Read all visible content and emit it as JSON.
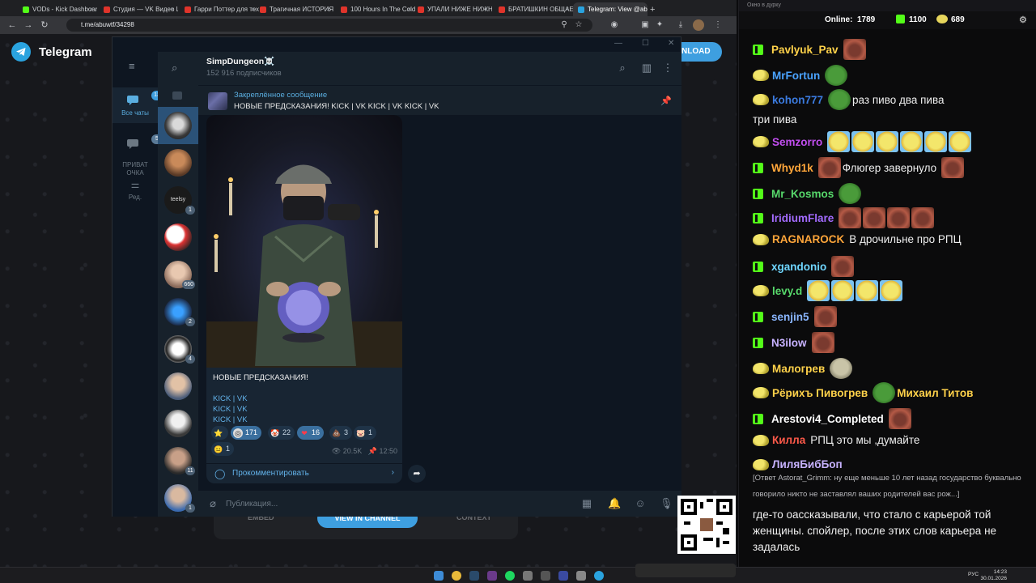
{
  "browser": {
    "tabs": [
      {
        "label": "VODs - Kick Dashboard",
        "color": "#53fc18"
      },
      {
        "label": "Студия — VK Видео Li",
        "color": "#e0342b"
      },
      {
        "label": "Гарри Поттер для тех",
        "color": "#e0342b"
      },
      {
        "label": "Трагичная ИСТОРИЯ",
        "color": "#e0342b"
      },
      {
        "label": "100 Hours In The Cold",
        "color": "#e0342b"
      },
      {
        "label": "УПАЛИ НИЖЕ НИЖН",
        "color": "#e0342b"
      },
      {
        "label": "БРАТИШКИН ОБЩАЕ",
        "color": "#e0342b"
      },
      {
        "label": "Telegram: View @abus",
        "color": "#2aa3df"
      }
    ],
    "url": "t.me/abuwtf/34298"
  },
  "page": {
    "brand": "Telegram",
    "download_label": "NLOAD",
    "bottom_buttons": {
      "embed": "EMBED",
      "view_channel": "VIEW IN CHANNEL",
      "context": "CONTEXT"
    }
  },
  "tg": {
    "folders": [
      {
        "label": "Все чаты",
        "badge": "13"
      },
      {
        "label": "ПРИВАТ\nОЧКА",
        "badge": "5"
      },
      {
        "label": "Ред.",
        "badge": ""
      }
    ],
    "chat_badges": [
      "1",
      "660",
      "2",
      "4",
      "11",
      "1"
    ],
    "channel": {
      "title": "SimpDungeon☠️",
      "subscribers": "152 916 подписчиков"
    },
    "pinned": {
      "label": "Закреплённое сообщение",
      "text": "НОВЫЕ ПРЕДСКАЗАНИЯ!  KICK | VK KICK | VK KICK | VK"
    },
    "post": {
      "title": "НОВЫЕ ПРЕДСКАЗАНИЯ!",
      "lines": [
        "KICK | VK",
        "KICK | VK",
        "KICK | VK"
      ],
      "reactions": [
        {
          "emoji": "⭐",
          "count": ""
        },
        {
          "emoji": "◎",
          "count": "171"
        },
        {
          "emoji": "🤡",
          "count": "22"
        },
        {
          "emoji": "❤",
          "count": "16"
        },
        {
          "emoji": "💩",
          "count": "3"
        },
        {
          "emoji": "🐷",
          "count": "1"
        },
        {
          "emoji": "😐",
          "count": "1"
        }
      ],
      "views": "20.5K",
      "time": "12:50",
      "comment_label": "Прокомментировать"
    },
    "input_placeholder": "Публикация..."
  },
  "taskbar": {
    "lang": "РУС",
    "time": "14:23",
    "date": "30.01.2026"
  },
  "stream_chat": {
    "window_title": "Окно в дурку",
    "online_label": "Online:",
    "online": "1789",
    "kick_count": "1100",
    "vk_count": "689",
    "messages": [
      {
        "badge": "kick",
        "name": "Pavlyuk_Pav",
        "color": "#ffd24a",
        "text": "",
        "emotes": [
          "face"
        ]
      },
      {
        "badge": "pepe",
        "name": "MrFortun",
        "color": "#4aa3ff",
        "text": "",
        "emotes": [
          "pepe"
        ]
      },
      {
        "badge": "pepe",
        "name": "kohon777",
        "color": "#3b7be0",
        "text": "раз пиво  два пива",
        "text2": "три пива",
        "emotes": [
          "pepe"
        ]
      },
      {
        "badge": "pepe",
        "name": "Semzorro",
        "color": "#c24ef0",
        "text": "",
        "emotes": [
          "yellow",
          "yellow",
          "yellow",
          "yellow",
          "yellow",
          "yellow"
        ]
      },
      {
        "badge": "kick",
        "name": "Whyd1k",
        "color": "#ffa63a",
        "text": "Флюгер завернуло",
        "emotes": [
          "face"
        ]
      },
      {
        "badge": "kick",
        "name": "Mr_Kosmos",
        "color": "#57d96b",
        "text": "",
        "emotes": [
          "pepe"
        ]
      },
      {
        "badge": "kick",
        "name": "IridiumFlare",
        "color": "#a36bff",
        "text": "",
        "emotes": [
          "face",
          "face",
          "face",
          "face"
        ]
      },
      {
        "badge": "pepe",
        "name": "RAGNAROCK",
        "color": "#ffa63a",
        "text": "В дрочильне про РПЦ",
        "emotes": []
      },
      {
        "badge": "kick",
        "name": "xgandonio",
        "color": "#6fd6ff",
        "text": "",
        "emotes": [
          "face"
        ]
      },
      {
        "badge": "pepe",
        "name": "levy.d",
        "color": "#57d96b",
        "text": "",
        "emotes": [
          "yellow",
          "yellow",
          "yellow",
          "yellow"
        ]
      },
      {
        "badge": "kick",
        "name": "senjin5",
        "color": "#8ab6ff",
        "text": "",
        "emotes": [
          "face"
        ]
      },
      {
        "badge": "kick",
        "name": "N3ilow",
        "color": "#c7b2ff",
        "text": "",
        "emotes": [
          "face"
        ]
      },
      {
        "badge": "pepe",
        "name": "Малогрев",
        "color": "#ffd24a",
        "text": "",
        "emotes": [
          "gray"
        ]
      },
      {
        "badge": "pepe",
        "name": "Рёрихъ Пивогрев",
        "color": "#ffd24a",
        "text": "Михаил Титов",
        "emotes": [
          "pepe"
        ]
      },
      {
        "badge": "kick",
        "name": "Arestovi4_Completed",
        "color": "#ffffff",
        "text": "",
        "emotes": [
          "face"
        ]
      },
      {
        "badge": "pepe",
        "name": "Килла",
        "color": "#ff5a4a",
        "text": "РПЦ это мы ,думайте",
        "emotes": []
      },
      {
        "badge": "pepe",
        "name": "ЛиляБибБоп",
        "color": "#c7b2ff",
        "text": "[Ответ Astorat_Grimm: ну еще меньше 10 лет назад государство буквально говорило никто не заставлял ваших родителей вас рож...]",
        "emotes": []
      }
    ],
    "last_message": "где-то оассказывали, что стало с карьерой той женщины. спойлер, после этих слов карьера не задалась"
  }
}
